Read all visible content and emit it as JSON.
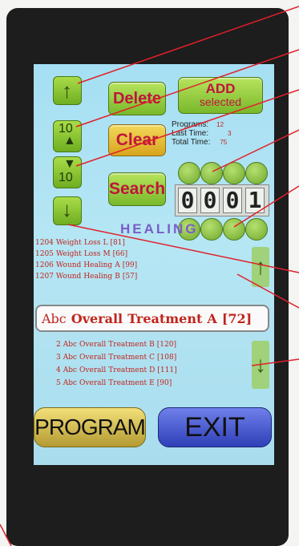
{
  "buttons": {
    "delete_label": "Delete",
    "add_selected_label_1": "ADD",
    "add_selected_label_2": "selected",
    "clear_label": "Clear",
    "search_label": "Search",
    "page_up_label": "10",
    "page_down_label": "10",
    "program_label": "PROGRAM",
    "exit_label": "EXIT"
  },
  "stats": {
    "programs_label": "Programs:",
    "programs_value": "12",
    "last_time_label": "Last Time:",
    "last_time_value": "3",
    "total_time_label": "Total Time:",
    "total_time_value": "75"
  },
  "counter": [
    "0",
    "0",
    "0",
    "1"
  ],
  "category_label": "HEALING",
  "upper_list": [
    {
      "num": "1204",
      "a": "Weight",
      "b": "Loss",
      "c": "L",
      "d": "[81]"
    },
    {
      "num": "1205",
      "a": "Weight",
      "b": "Loss",
      "c": "M",
      "d": "[66]"
    },
    {
      "num": "1206",
      "a": "Wound",
      "b": "Healing",
      "c": "A",
      "d": "[99]"
    },
    {
      "num": "1207",
      "a": "Wound",
      "b": "Healing",
      "c": "B",
      "d": "[57]"
    }
  ],
  "selected_item": {
    "a": "Abc",
    "b": "Overall",
    "c": "Treatment",
    "d": "A",
    "e": "[72]"
  },
  "lower_list": [
    {
      "num": "2",
      "a": "Abc",
      "b": "Overall",
      "c": "Treatment",
      "d": "B",
      "e": "[120]"
    },
    {
      "num": "3",
      "a": "Abc",
      "b": "Overall",
      "c": "Treatment",
      "d": "C",
      "e": "[108]"
    },
    {
      "num": "4",
      "a": "Abc",
      "b": "Overall",
      "c": "Treatment",
      "d": "D",
      "e": "[111]"
    },
    {
      "num": "5",
      "a": "Abc",
      "b": "Overall",
      "c": "Treatment",
      "d": "E",
      "e": "[90]"
    }
  ],
  "colors": {
    "accent_red": "#c0143c",
    "button_green": "#8fcb3e",
    "exit_blue": "#3a4fc8"
  },
  "icons": [
    "arrow-up-icon",
    "arrow-down-icon",
    "up-10-icon",
    "down-10-icon",
    "scroll-up-icon",
    "scroll-down-icon"
  ]
}
